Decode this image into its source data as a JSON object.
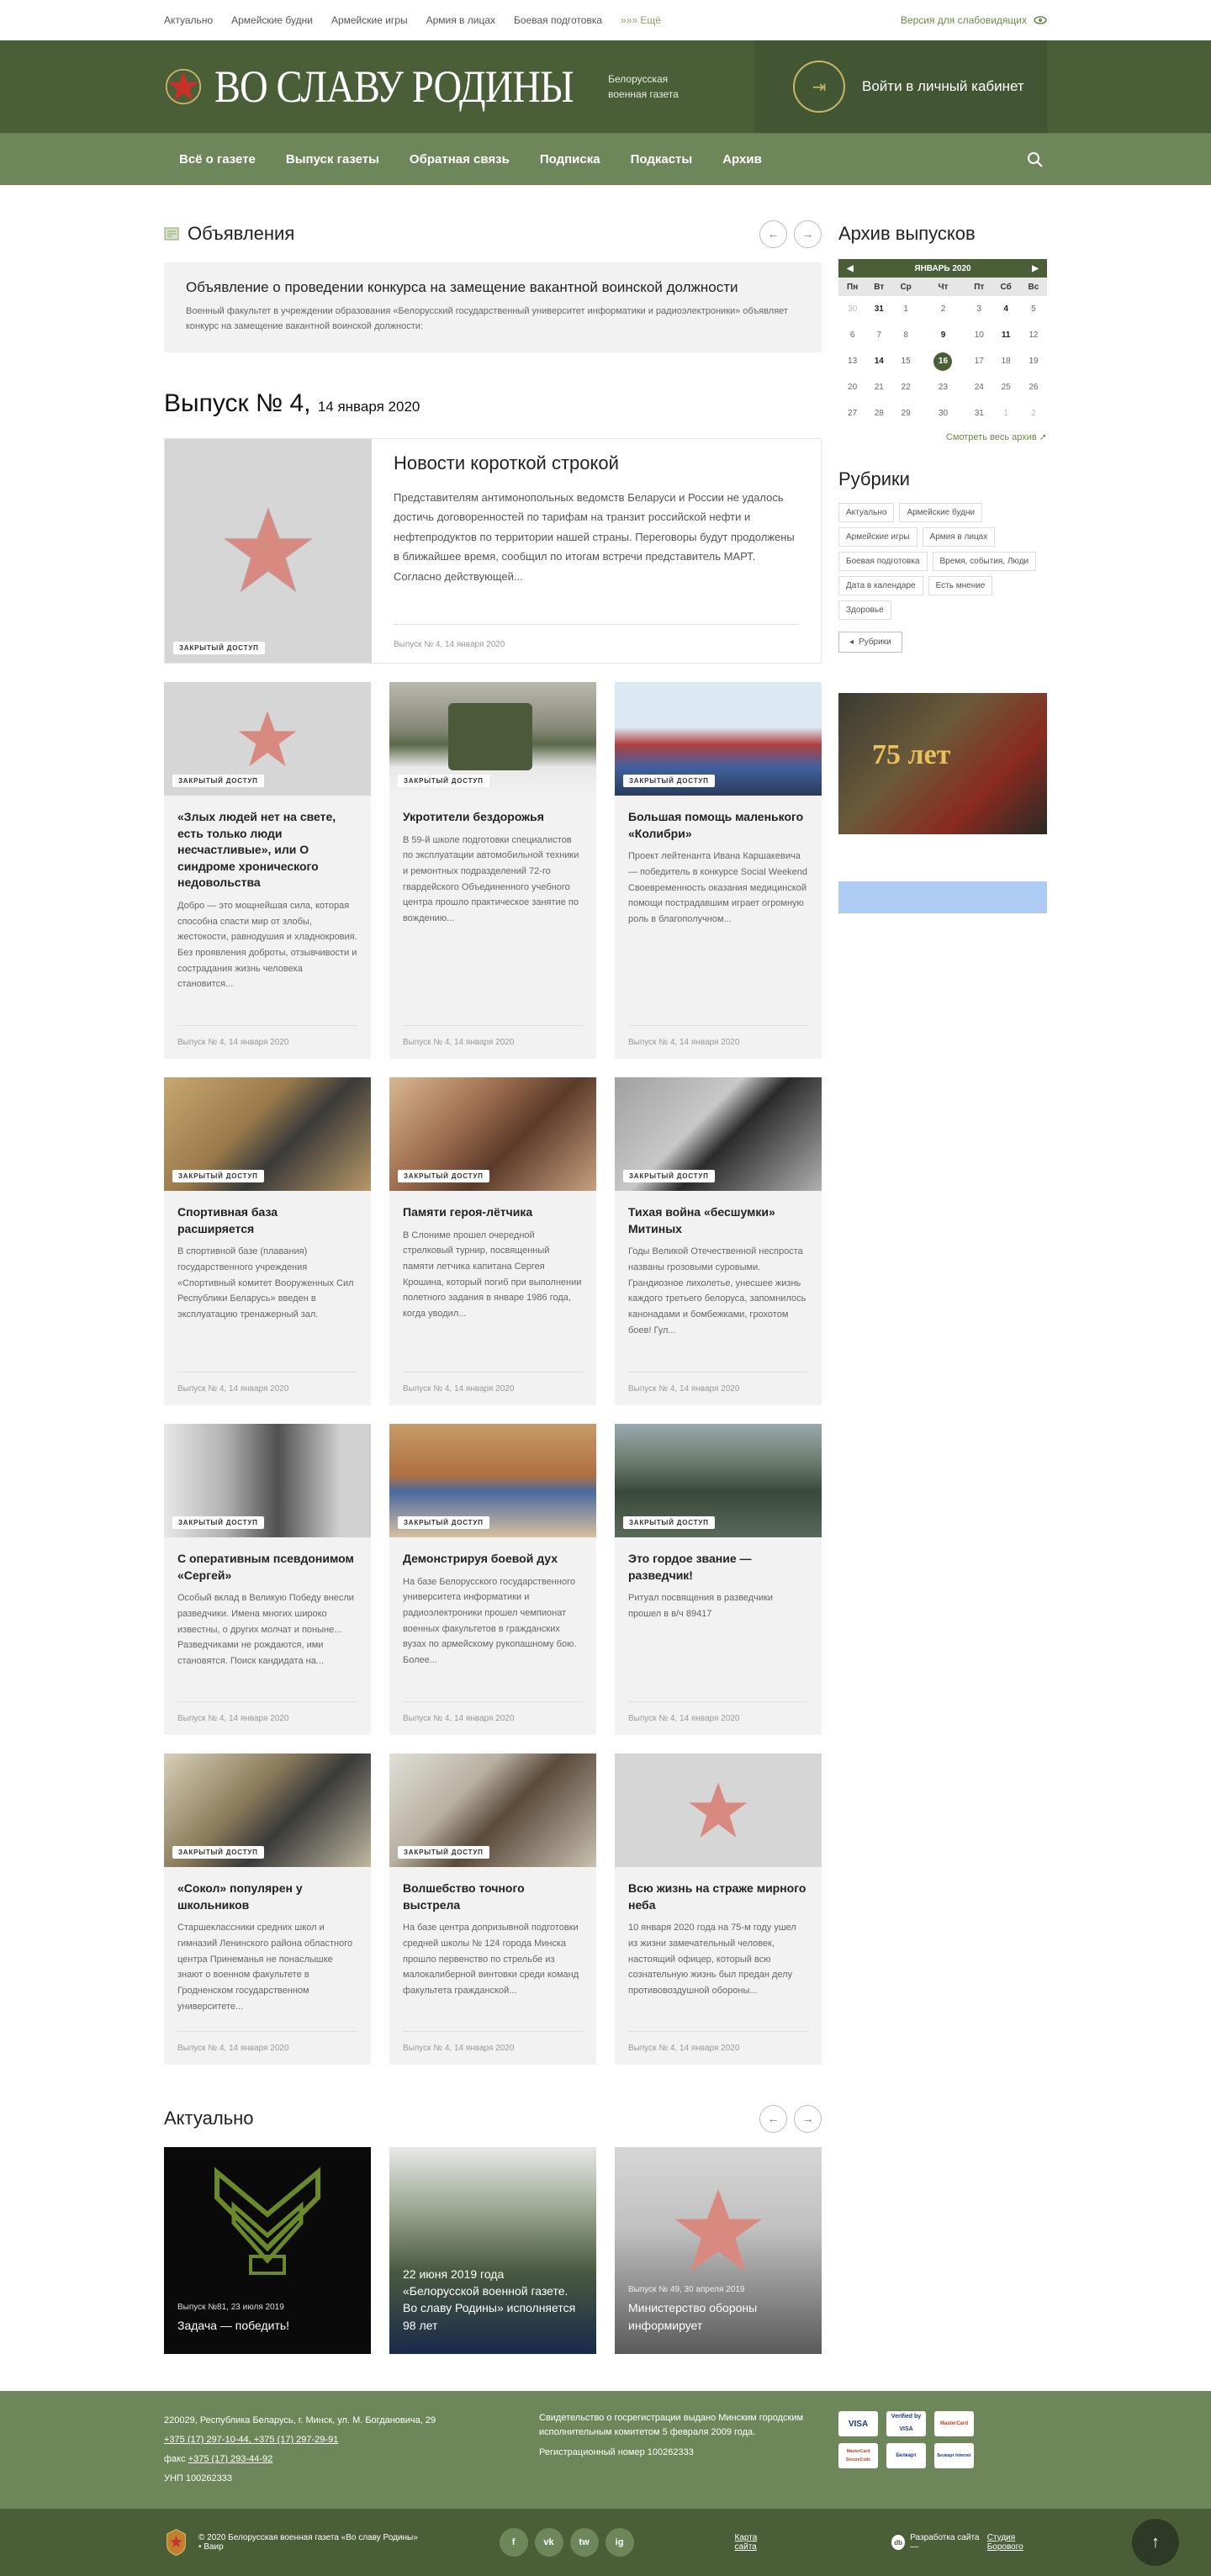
{
  "topbar": {
    "links": [
      "Актуально",
      "Армейские будни",
      "Армейские игры",
      "Армия в лицах",
      "Боевая подготовка"
    ],
    "more": "»»» Ещё",
    "vision": "Версия для слабовидящих"
  },
  "header": {
    "brand": "ВО СЛАВУ РОДИНЫ",
    "subtitle_1": "Белорусская",
    "subtitle_2": "военная газета",
    "cabinet": "Войти в личный кабинет"
  },
  "nav": [
    "Всё о газете",
    "Выпуск газеты",
    "Обратная связь",
    "Подписка",
    "Подкасты",
    "Архив"
  ],
  "announcements": {
    "title": "Объявления",
    "item_title": "Объявление о проведении конкурса на замещение вакантной воинской должности",
    "item_text": "Военный факультет в учреждении образования «Белорусский государственный университет информатики и радиоэлектроники» объявляет конкурс на замещение вакантной воинской должности:"
  },
  "issue": {
    "title": "Выпуск № 4,",
    "date": "14 января 2020"
  },
  "badge": "ЗАКРЫТЫЙ ДОСТУП",
  "feature": {
    "title": "Новости короткой строкой",
    "text": "Представителям антимонопольных ведомств Беларуси и России не удалось достичь договоренностей по тарифам на транзит российской нефти и нефтепродуктов по территории нашей страны. Переговоры будут продолжены в ближайшее время, сообщил по итогам встречи представитель МАРТ. Согласно действующей...",
    "meta": "Выпуск № 4, 14 января 2020"
  },
  "articles": [
    {
      "title": "«Злых людей нет на свете, есть только люди несчастливые», или О синдроме хронического недовольства",
      "text": "Добро — это мощнейшая сила, которая способна спасти мир от злобы, жестокости, равнодушия и хладнокровия. Без проявления доброты, отзывчивости и сострадания жизнь человека становится...",
      "meta": "Выпуск № 4, 14 января 2020"
    },
    {
      "title": "Укротители бездорожья",
      "text": "В 59-й школе подготовки специалистов по эксплуатации автомобильной техники и ремонтных подразделений 72-го гвардейского Объединенного учебного центра прошло практическое занятие по вождению...",
      "meta": "Выпуск № 4, 14 января 2020"
    },
    {
      "title": "Большая помощь маленького «Колибри»",
      "text": "Проект лейтенанта Ивана Каршакевича — победитель в конкурсе Social Weekend Своевременность оказания медицинской помощи пострадавшим играет огромную роль в благополучном...",
      "meta": "Выпуск № 4, 14 января 2020"
    },
    {
      "title": "Спортивная база расширяется",
      "text": "В спортивной базе (плавания) государственного учреждения «Спортивный комитет Вооруженных Сил Республики Беларусь» введен в эксплуатацию тренажерный зал.",
      "meta": "Выпуск № 4, 14 января 2020"
    },
    {
      "title": "Памяти героя-лётчика",
      "text": "В Слониме прошел очередной стрелковый турнир, посвященный памяти летчика капитана Сергея Крошина, который погиб при выполнении полетного задания в январе 1986 года, когда уводил...",
      "meta": "Выпуск № 4, 14 января 2020"
    },
    {
      "title": "Тихая война «бесшумки» Митиных",
      "text": "Годы Великой Отечественной неспроста названы грозовыми суровыми. Грандиозное лихолетье, унесшее жизнь каждого третьего белоруса, запомнилось канонадами и бомбежками, грохотом боев! Гул...",
      "meta": "Выпуск № 4, 14 января 2020"
    },
    {
      "title": "С оперативным псевдонимом «Сергей»",
      "text": "Особый вклад в Великую Победу внесли разведчики. Имена многих широко известны, о других молчат и поныне... Разведчиками не рождаются, ими становятся. Поиск кандидата на...",
      "meta": "Выпуск № 4, 14 января 2020"
    },
    {
      "title": "Демонстрируя боевой дух",
      "text": "На базе Белорусского государственного университета информатики и радиоэлектроники прошел чемпионат военных факультетов в гражданских вузах по армейскому рукопашному бою. Более...",
      "meta": "Выпуск № 4, 14 января 2020"
    },
    {
      "title": "Это гордое звание — разведчик!",
      "text": "Ритуал посвящения в разведчики прошел в в/ч 89417",
      "meta": "Выпуск № 4, 14 января 2020"
    },
    {
      "title": "«Сокол» популярен у школьников",
      "text": "Старшеклассники средних школ и гимназий Ленинского района областного центра Принеманья не понаслышке знают о военном факультете в Гродненском государственном университете...",
      "meta": "Выпуск № 4, 14 января 2020"
    },
    {
      "title": "Волшебство точного выстрела",
      "text": "На базе центра допризывной подготовки средней школы № 124 города Минска прошло первенство по стрельбе из малокалиберной винтовки среди команд факультета гражданской...",
      "meta": "Выпуск № 4, 14 января 2020"
    },
    {
      "title": "Всю жизнь на страже мирного неба",
      "text": "10 января 2020 года на 75-м году ушел из жизни замечательный человек, настоящий офицер, который всю сознательную жизнь был предан делу противовоздушной обороны...",
      "meta": "Выпуск № 4, 14 января 2020"
    }
  ],
  "actual": {
    "title": "Актуально",
    "items": [
      {
        "meta": "Выпуск №81, 23 июля 2019",
        "title": "Задача — победить!"
      },
      {
        "meta": "",
        "title": "22 июня 2019 года «Белорусской военной газете. Во славу Родины» исполняется 98 лет"
      },
      {
        "meta": "Выпуск № 49, 30 апреля 2019",
        "title": "Министерство обороны информирует"
      }
    ]
  },
  "sidebar": {
    "archive_title": "Архив выпусков",
    "month": "ЯНВАРЬ 2020",
    "weekdays": [
      "Пн",
      "Вт",
      "Ср",
      "Чт",
      "Пт",
      "Сб",
      "Вс"
    ],
    "see_all": "Смотреть весь архив",
    "rubrics_title": "Рубрики",
    "tags": [
      "Актуально",
      "Армейские будни",
      "Армейские игры",
      "Армия в лицах",
      "Боевая подготовка",
      "Время, события, Люди",
      "Дата в календаре",
      "Есть мнение",
      "Здоровье"
    ],
    "rubrics_button": "Рубрики",
    "banner_number": "75 лет"
  },
  "footer": {
    "address": "220029, Республика Беларусь, г. Минск, ул. М. Богдановича, 29",
    "phones": "+375 (17) 297-10-44, +375 (17) 297-29-91",
    "fax_label": "факс",
    "fax": "+375 (17) 293-44-92",
    "unp": "УНП 100262333",
    "certificate": "Свидетельство о госрегистрации выдано Минским городским исполнительным комитетом 5 февраля 2009 года.",
    "reg": "Регистрационный номер 100262333",
    "payments": [
      "VISA",
      "Verified by VISA",
      "MasterCard",
      "MasterCard SecureCode",
      "Белкарт",
      "Белкарт Internet",
      "ЕРИП"
    ],
    "copyright": "© 2020 Белорусская военная газета «Во славу Родины» • Ваир",
    "socials": [
      "f",
      "vk",
      "tw",
      "ig"
    ],
    "map": "Карта сайта",
    "dev_label": "Разработка сайта —",
    "dev_name": "Студия Борового"
  },
  "colors": {
    "header": "#4a5e38",
    "nav": "#6d875a",
    "accent": "#6a8a4a"
  }
}
